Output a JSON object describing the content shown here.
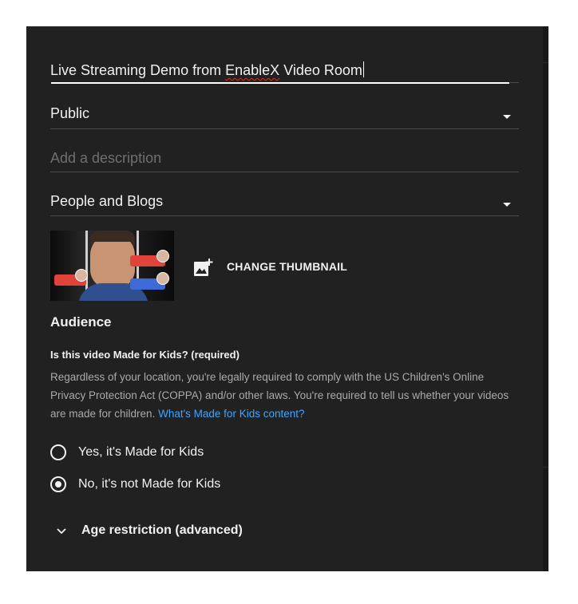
{
  "title_field": {
    "value_pre": "Live Streaming Demo from ",
    "value_misspelled": "EnableX",
    "value_post": " Video Room"
  },
  "visibility_select": {
    "value": "Public",
    "icon": "dropdown-arrow-icon"
  },
  "description_field": {
    "placeholder": "Add a description"
  },
  "category_select": {
    "value": "People and Blogs",
    "icon": "dropdown-arrow-icon"
  },
  "thumbnail": {
    "change_label": "CHANGE THUMBNAIL",
    "icon": "add-photo-icon"
  },
  "audience": {
    "heading": "Audience",
    "question": "Is this video Made for Kids? (required)",
    "description": "Regardless of your location, you're legally required to comply with the US Children's Online Privacy Protection Act (COPPA) and/or other laws. You're required to tell us whether your videos are made for children. ",
    "link_text": "What's Made for Kids content?",
    "options": [
      {
        "label": "Yes, it's Made for Kids",
        "selected": false
      },
      {
        "label": "No, it's not Made for Kids",
        "selected": true
      }
    ]
  },
  "age_restriction": {
    "label": "Age restriction (advanced)",
    "icon": "chevron-down-icon"
  },
  "colors": {
    "panel": "#212121",
    "text": "#f1f1f1",
    "muted": "#aaaaaa",
    "link": "#3ea6ff",
    "divider": "#4a4a4a"
  }
}
